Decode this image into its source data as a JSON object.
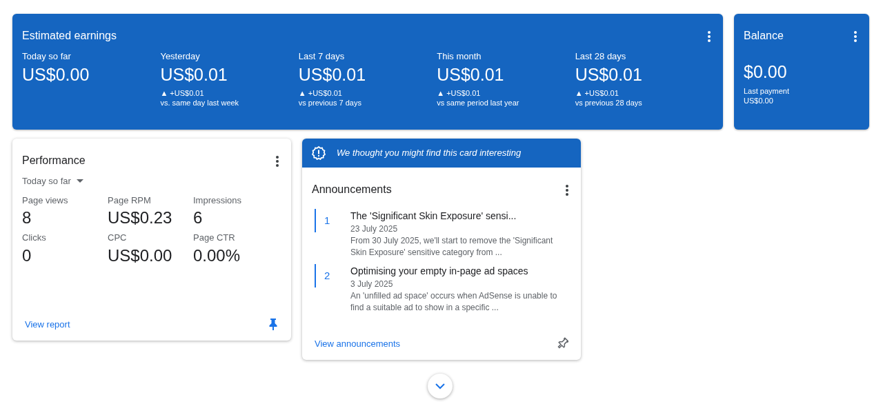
{
  "earnings": {
    "title": "Estimated earnings",
    "periods": [
      {
        "label": "Today so far",
        "amount": "US$0.00"
      },
      {
        "label": "Yesterday",
        "amount": "US$0.01",
        "change": "▲ +US$0.01",
        "comparison": "vs. same day last week"
      },
      {
        "label": "Last 7 days",
        "amount": "US$0.01",
        "change": "▲ +US$0.01",
        "comparison": "vs previous 7 days"
      },
      {
        "label": "This month",
        "amount": "US$0.01",
        "change": "▲ +US$0.01",
        "comparison": "vs same period last year"
      },
      {
        "label": "Last 28 days",
        "amount": "US$0.01",
        "change": "▲ +US$0.01",
        "comparison": "vs previous 28 days"
      }
    ]
  },
  "balance": {
    "title": "Balance",
    "amount": "$0.00",
    "last_payment_label": "Last payment",
    "last_payment": "US$0.00"
  },
  "performance": {
    "title": "Performance",
    "range": "Today so far",
    "pinned": true,
    "link": "View report",
    "metrics": [
      {
        "label": "Page views",
        "value": "8"
      },
      {
        "label": "Page RPM",
        "value": "US$0.23"
      },
      {
        "label": "Impressions",
        "value": "6"
      },
      {
        "label": "Clicks",
        "value": "0"
      },
      {
        "label": "CPC",
        "value": "US$0.00"
      },
      {
        "label": "Page CTR",
        "value": "0.00%"
      }
    ]
  },
  "announcements": {
    "banner": "We thought you might find this card interesting",
    "title": "Announcements",
    "pinned": false,
    "link": "View announcements",
    "items": [
      {
        "number": "1",
        "title": "The 'Significant Skin Exposure' sensi...",
        "date": "23 July 2025",
        "summary": "From 30 July 2025, we'll start to remove the 'Significant Skin Exposure' sensitive category from ..."
      },
      {
        "number": "2",
        "title": "Optimising your empty in-page ad spaces",
        "date": "3 July 2025",
        "summary": "An 'unfilled ad space' occurs when AdSense is unable to find a suitable ad to show in a specific ..."
      }
    ]
  }
}
